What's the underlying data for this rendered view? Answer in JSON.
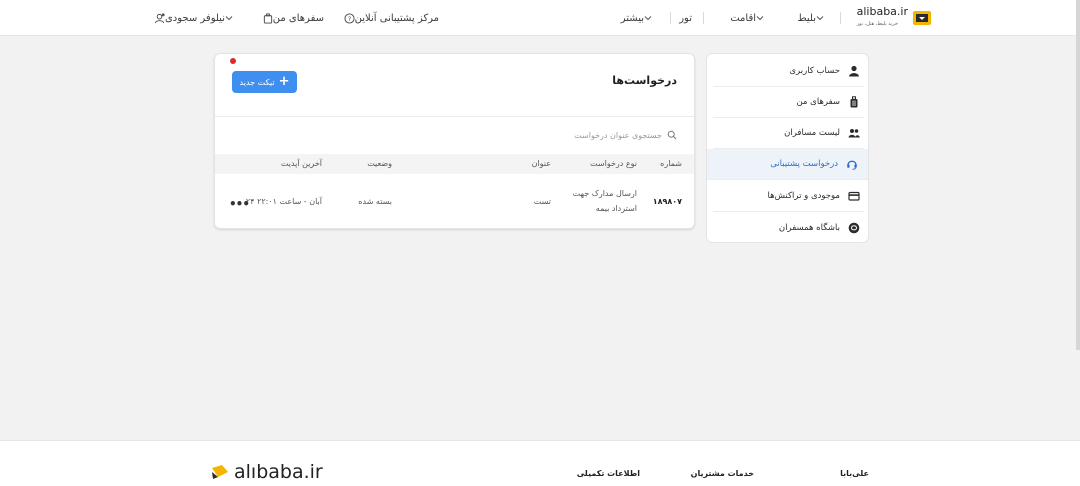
{
  "header": {
    "logo_text": "alibaba.ir",
    "logo_sub": "خرید بلیط، هتل، تور",
    "nav": [
      {
        "label": "بلیط"
      },
      {
        "label": "اقامت"
      },
      {
        "label": "تور"
      },
      {
        "label": "بیشتر"
      }
    ],
    "support_center": "مرکز پشتیبانی آنلاین",
    "my_trips": "سفرهای من",
    "user_name": "نیلوفر سجودی"
  },
  "sidebar": {
    "items": [
      {
        "label": "حساب کاربری",
        "icon": "user-icon"
      },
      {
        "label": "سفرهای من",
        "icon": "suitcase-icon"
      },
      {
        "label": "لیست مسافران",
        "icon": "users-icon"
      },
      {
        "label": "درخواست پشتیبانی",
        "icon": "headset-icon"
      },
      {
        "label": "موجودی و تراکنش‌ها",
        "icon": "wallet-icon"
      },
      {
        "label": "باشگاه همسفران",
        "icon": "club-icon"
      }
    ]
  },
  "requests": {
    "title": "درخواست‌ها",
    "new_ticket": "تیکت جدید",
    "search_placeholder": "جستجوی عنوان درخواست",
    "columns": [
      "شماره",
      "نوع درخواست",
      "عنوان",
      "وضعیت",
      "آخرین آپدیت"
    ],
    "rows": [
      {
        "number": "۱۸۹۸۰۷",
        "type_line1": "ارسال مدارک جهت",
        "type_line2": "استرداد بیمه",
        "title": "تست",
        "status": "بسته شده",
        "updated": "۲۴ آبان - ساعت ۲۲:۰۱",
        "more": "•••"
      }
    ]
  },
  "footer": {
    "col1": "علی‌بابا",
    "col2": "خدمات مشتریان",
    "col3": "اطلاعات تکمیلی",
    "logo_text": "alıbaba.ir"
  },
  "colors": {
    "accent": "#3f8ff0",
    "active_bg": "#eef3fa",
    "active_text": "#2b6cc8",
    "alert_dot": "#d92c2c",
    "brand_yellow": "#f5b400"
  }
}
